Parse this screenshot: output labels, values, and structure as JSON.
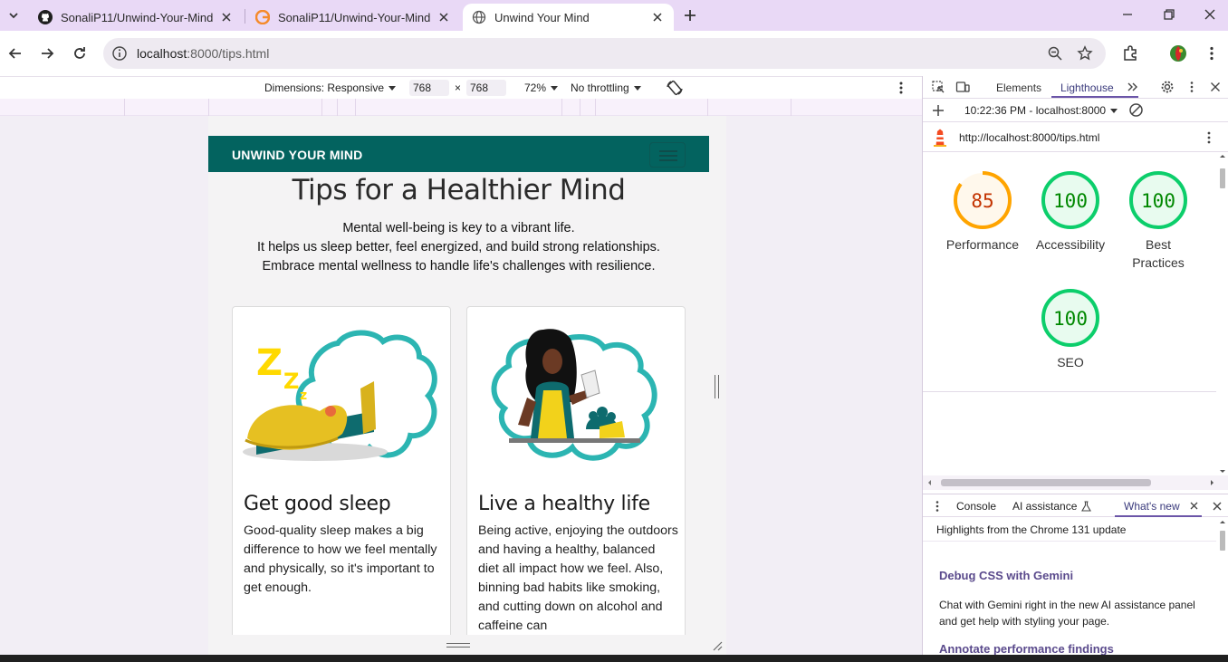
{
  "browser": {
    "tabs": [
      {
        "title": "SonaliP11/Unwind-Your-Mind",
        "icon": "github-icon"
      },
      {
        "title": "SonaliP11/Unwind-Your-Mind -",
        "icon": "github-pages-icon"
      },
      {
        "title": "Unwind Your Mind",
        "icon": "globe-icon"
      }
    ],
    "url_host": "localhost",
    "url_path": ":8000/tips.html"
  },
  "device_toolbar": {
    "dimensions_label": "Dimensions: Responsive",
    "width": "768",
    "height": "768",
    "times": "×",
    "zoom": "72%",
    "throttling": "No throttling"
  },
  "site": {
    "brand": "UNWIND YOUR MIND",
    "title": "Tips for a Healthier Mind",
    "intro": [
      "Mental well-being is key to a vibrant life.",
      "It helps us sleep better, feel energized, and build strong relationships.",
      "Embrace mental wellness to handle life's challenges with resilience."
    ],
    "cards": [
      {
        "title": "Get good sleep",
        "text": "Good-quality sleep makes a big difference to how we feel mentally and physically, so it's important to get enough."
      },
      {
        "title": "Live a healthy life",
        "text": "Being active, enjoying the outdoors and having a healthy, balanced diet all impact how we feel. Also, binning bad habits like smoking, and cutting down on alcohol and caffeine can"
      }
    ]
  },
  "devtools": {
    "tabs": [
      "Elements",
      "Lighthouse"
    ],
    "report_time": "10:22:36 PM - localhost:8000",
    "report_url": "http://localhost:8000/tips.html",
    "scores": [
      {
        "value": "85",
        "label": "Performance",
        "score": 85,
        "color": "#ffa400"
      },
      {
        "value": "100",
        "label": "Accessibility",
        "score": 100,
        "color": "#0cce6b"
      },
      {
        "value": "100",
        "label": "Best",
        "label2": "Practices",
        "score": 100,
        "color": "#0cce6b"
      },
      {
        "value": "100",
        "label": "SEO",
        "score": 100,
        "color": "#0cce6b"
      }
    ],
    "drawer_tabs": [
      "Console",
      "AI assistance",
      "What's new"
    ],
    "whats_new": {
      "header": "Highlights from the Chrome 131 update",
      "section1_title": "Debug CSS with Gemini",
      "section1_text": "Chat with Gemini right in the new AI assistance panel and get help with styling your page.",
      "section2_title": "Annotate performance findings"
    }
  }
}
